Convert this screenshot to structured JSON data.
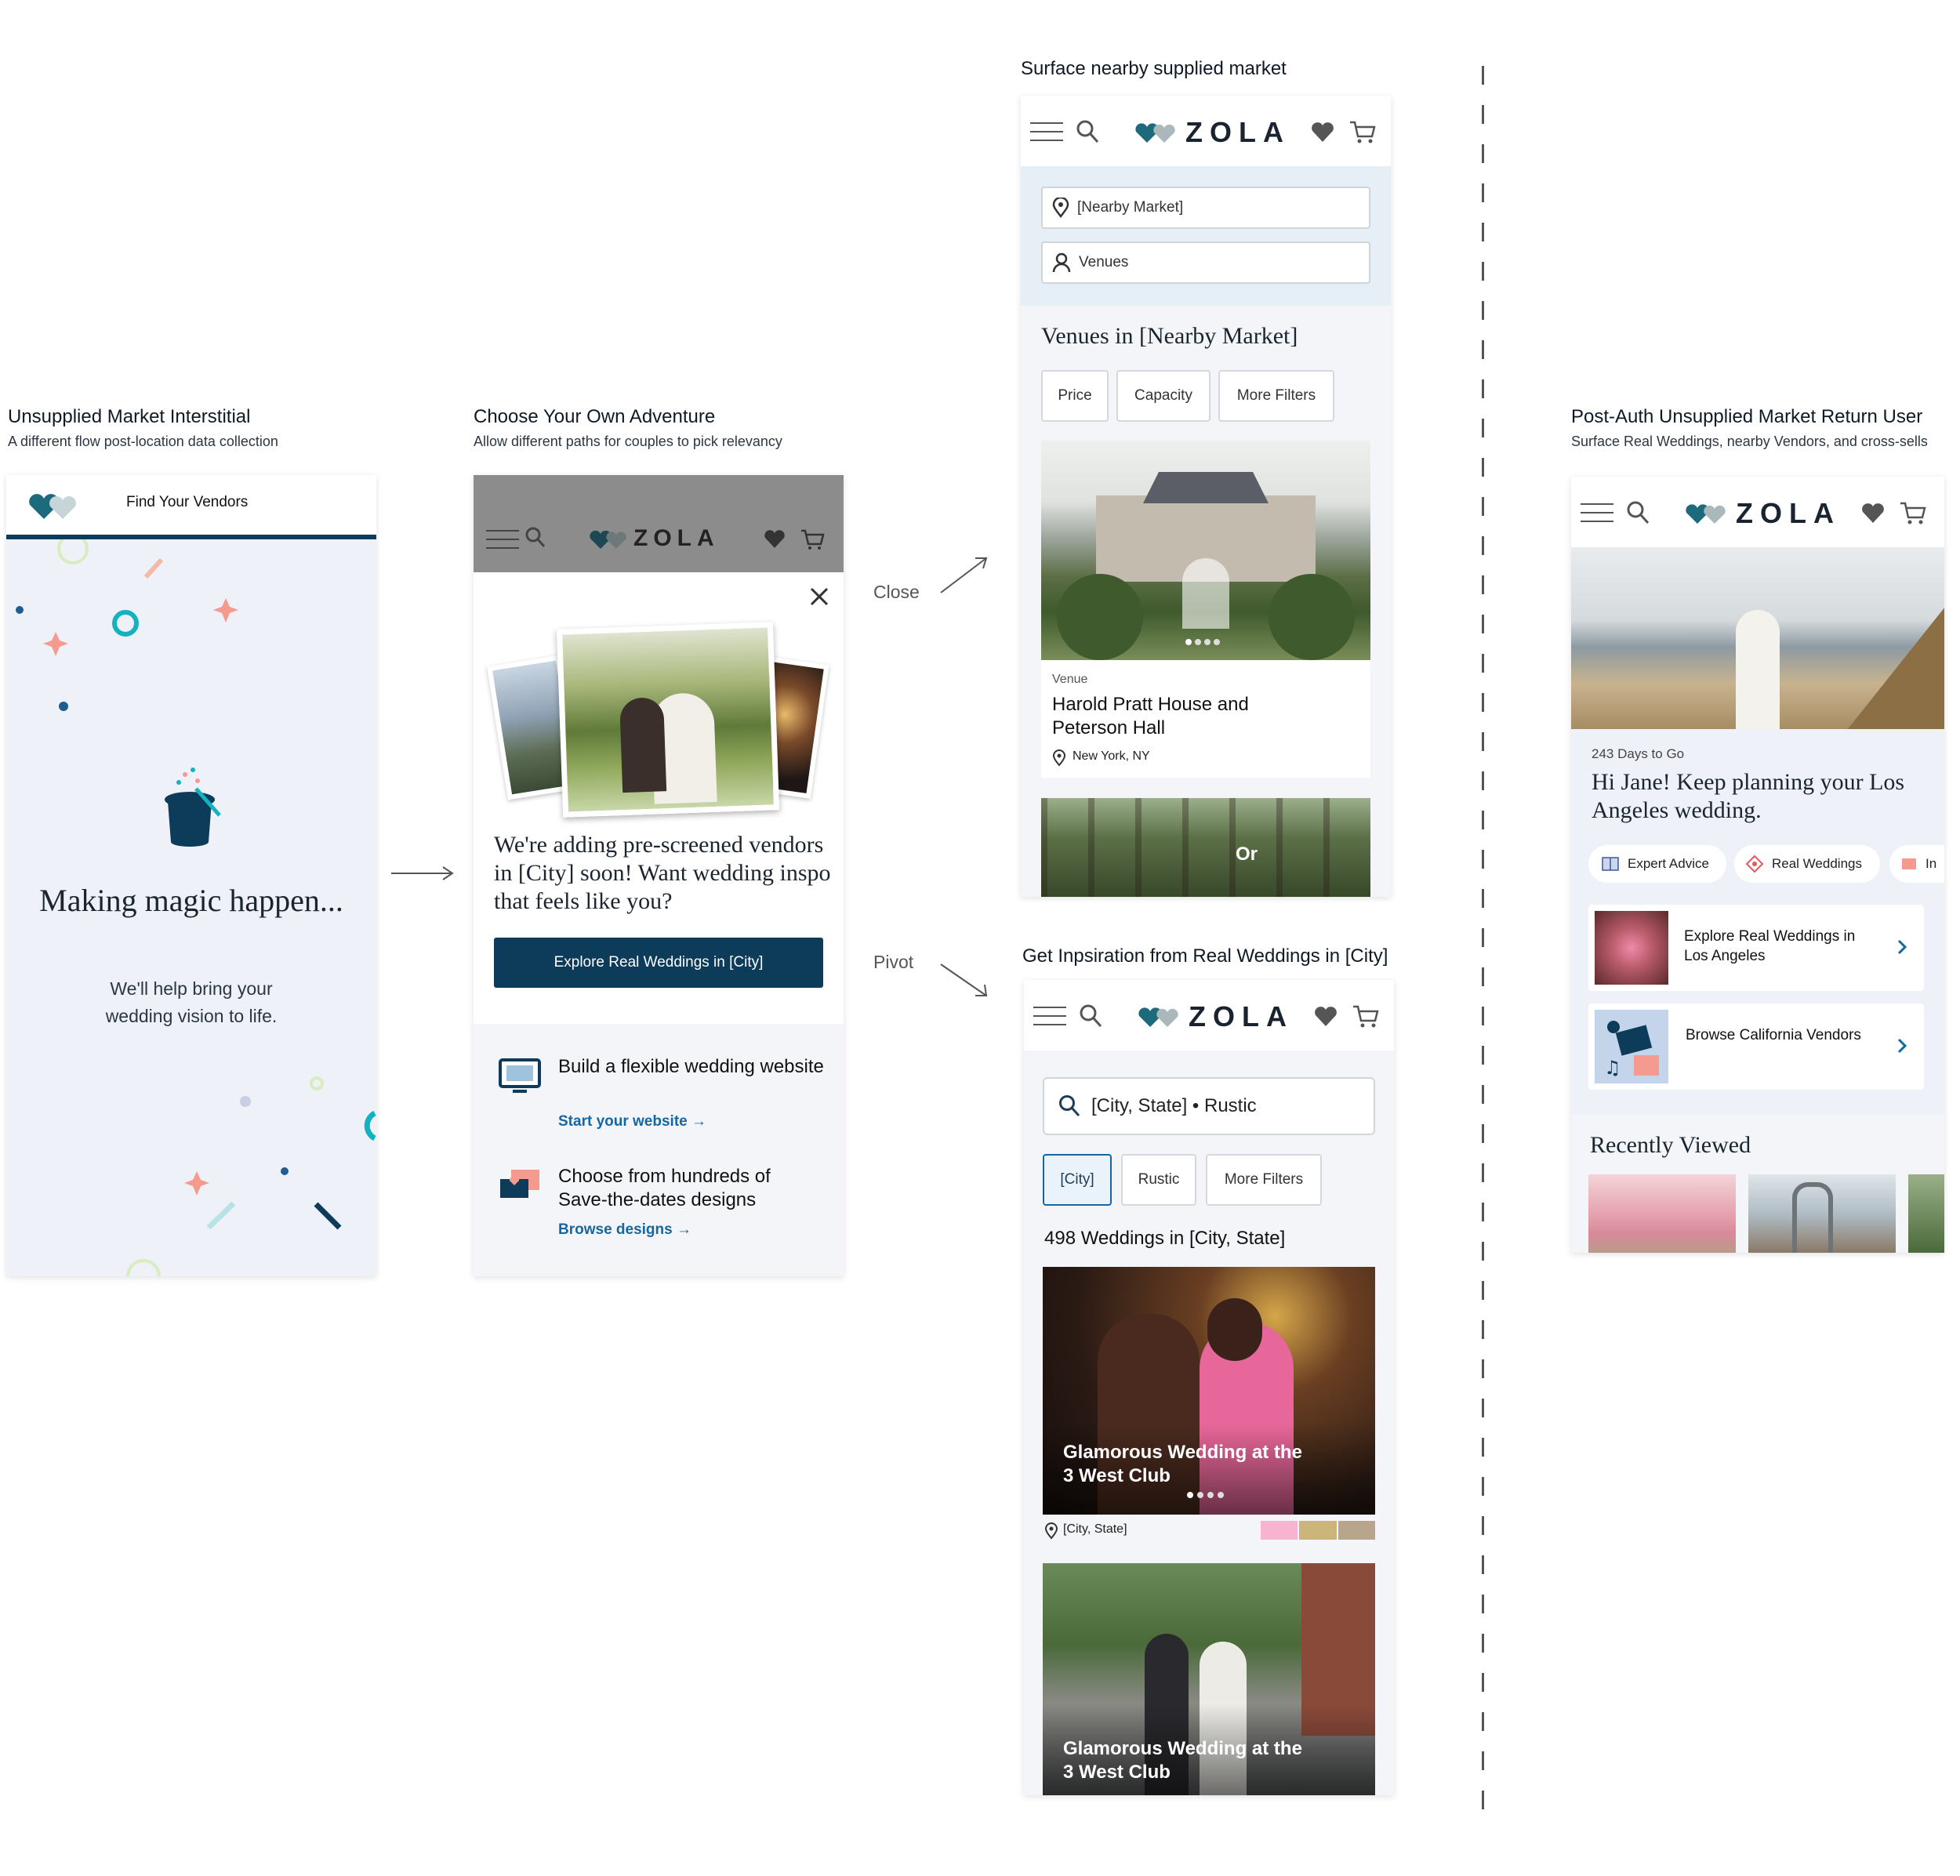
{
  "sections": {
    "s1": {
      "title": "Unsupplied Market Interstitial",
      "subtitle": "A different flow post-location data collection"
    },
    "s2": {
      "title": "Choose Your Own Adventure",
      "subtitle": "Allow different paths for couples to pick relevancy"
    },
    "s3": {
      "title": "Surface nearby supplied market"
    },
    "s4": {
      "title": "Get Inpsiration from Real Weddings in [City]"
    },
    "s5": {
      "title": "Post-Auth Unsupplied Market Return User",
      "subtitle": "Surface Real Weddings, nearby Vendors, and cross-sells"
    }
  },
  "arrows": {
    "close_label": "Close",
    "pivot_label": "Pivot"
  },
  "brand": {
    "logo_text": "ZOLA",
    "navy": "#0d3b5a",
    "teal": "#2a7f8f",
    "panel_blue": "#eef1f8"
  },
  "screen1": {
    "header_title": "Find Your Vendors",
    "headline": "Making magic happen...",
    "body": "We'll help bring your wedding vision to life."
  },
  "screen2": {
    "headline": "We're adding pre-screened vendors in [City] soon! Want wedding inspo that feels like you?",
    "cta": "Explore Real Weddings in [City]",
    "item1_title": "Build a flexible wedding website",
    "item1_link": "Start your website →",
    "item2_title": "Choose from hundreds of Save-the-dates designs",
    "item2_link": "Browse designs →"
  },
  "screen3": {
    "location_value": "[Nearby Market]",
    "category_value": "Venues",
    "heading": "Venues in [Nearby Market]",
    "filters": [
      "Price",
      "Capacity",
      "More Filters"
    ],
    "card_label": "Venue",
    "card_title": "Harold Pratt House and Peterson Hall",
    "card_location": "New York, NY",
    "or_label": "Or"
  },
  "screen4": {
    "search_value": "[City, State] • Rustic",
    "filters": [
      "[City]",
      "Rustic",
      "More Filters"
    ],
    "count_heading": "498 Weddings in [City, State]",
    "card1_title": "Glamorous Wedding at the 3 West Club",
    "card1_location": "[City, State]",
    "card1_palette": [
      "#f7b3d0",
      "#cbb57a",
      "#b8a68c"
    ],
    "card2_title": "Glamorous Wedding at the 3 West Club"
  },
  "screen5": {
    "countdown": "243 Days to Go",
    "greeting": "Hi Jane! Keep planning your Los Angeles wedding.",
    "pills": [
      "Expert Advice",
      "Real Weddings",
      "In"
    ],
    "card1": "Explore Real Weddings in Los Angeles",
    "card2": "Browse California Vendors",
    "recent_heading": "Recently Viewed"
  }
}
